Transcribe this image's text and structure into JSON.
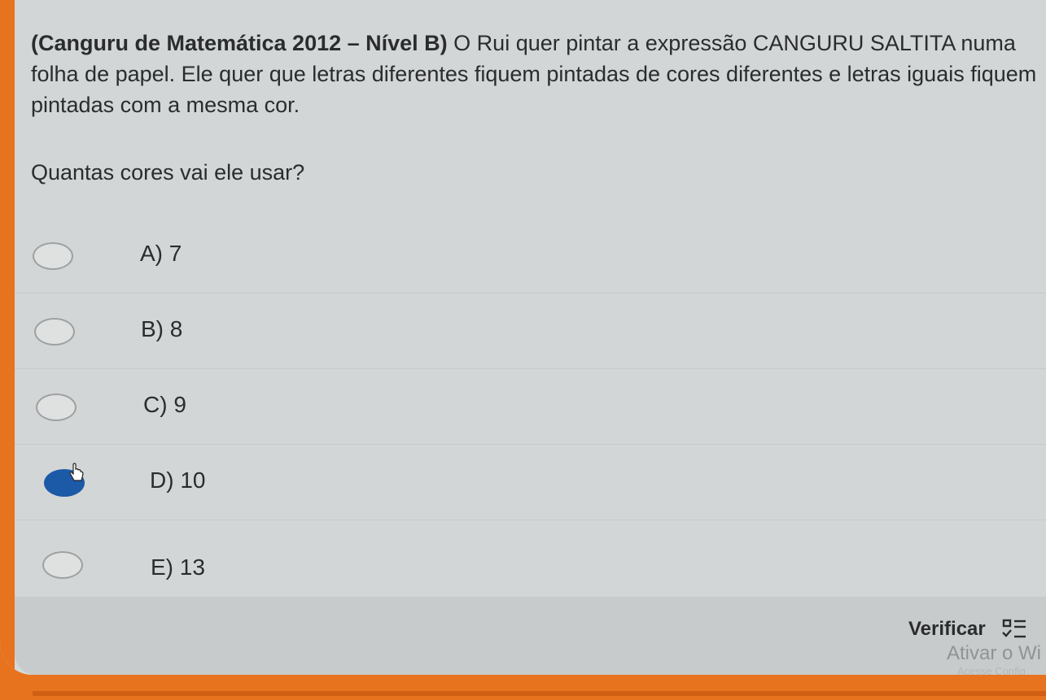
{
  "question": {
    "source_bold": "(Canguru de Matemática 2012 – Nível B)",
    "text": " O Rui quer pintar a expressão CANGURU SALTITA numa folha de papel. Ele quer que letras diferentes fiquem pintadas de cores diferentes e letras iguais fiquem pintadas com a mesma cor."
  },
  "prompt": "Quantas cores vai ele usar?",
  "options": [
    {
      "label": "A) 7",
      "selected": false
    },
    {
      "label": "B) 8",
      "selected": false
    },
    {
      "label": "C) 9",
      "selected": false
    },
    {
      "label": "D) 10",
      "selected": true
    },
    {
      "label": "E) 13",
      "selected": false
    }
  ],
  "footer": {
    "verify_label": "Verificar",
    "watermark": "Ativar o Wi",
    "watermark_sub": "Acesse Config"
  },
  "colors": {
    "accent": "#1c5aa8",
    "frame": "#e8731f"
  }
}
